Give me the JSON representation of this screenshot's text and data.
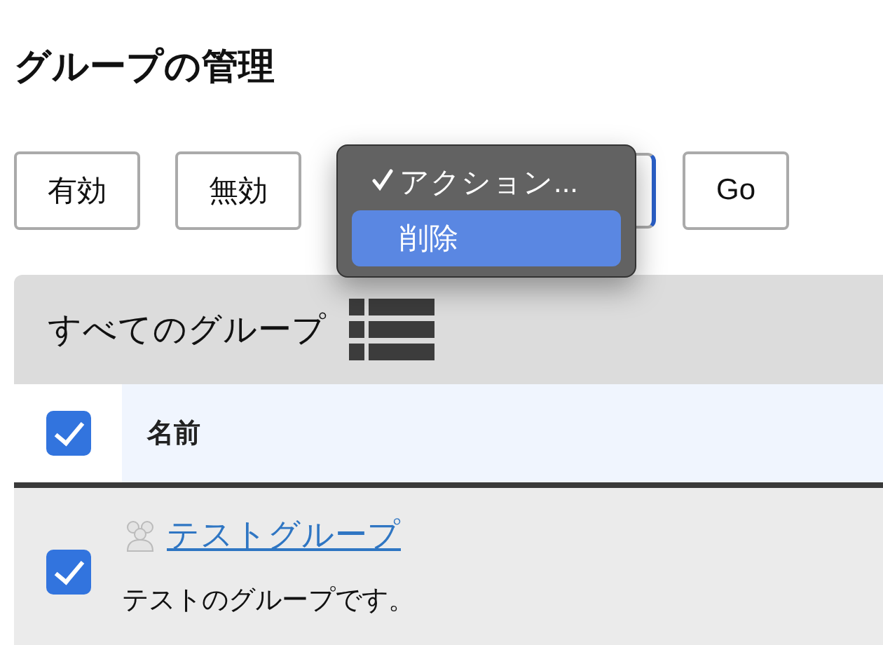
{
  "page_title": "グループの管理",
  "actions": {
    "buttons": [
      "有効",
      "無効"
    ],
    "select_menu": [
      {
        "label": "アクション...",
        "selected": true,
        "highlighted": false
      },
      {
        "label": "削除",
        "selected": false,
        "highlighted": true
      }
    ],
    "go_button": "Go"
  },
  "panel": {
    "title": "すべてのグループ",
    "columns": [
      {
        "label": "名前"
      }
    ],
    "header_checked": true,
    "rows": [
      {
        "checked": true,
        "name": "テストグループ",
        "description": "テストのグループです。"
      }
    ]
  }
}
